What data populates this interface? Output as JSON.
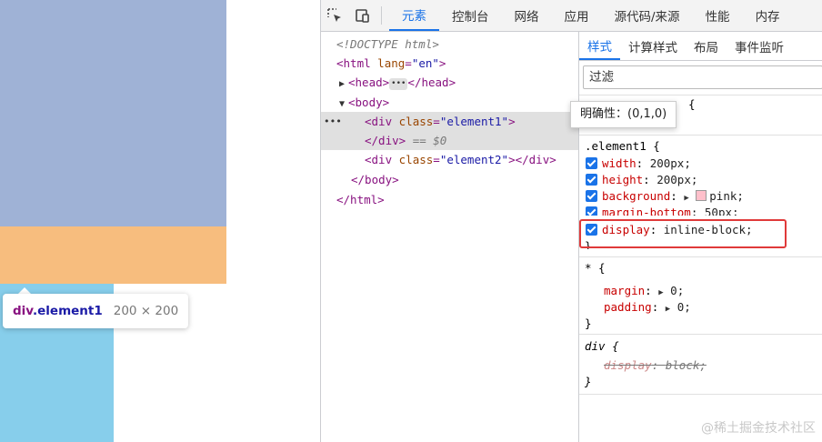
{
  "preview": {
    "tooltip_tag": "div",
    "tooltip_class": ".element1",
    "tooltip_size": "200 × 200"
  },
  "devtools": {
    "tabs": [
      "元素",
      "控制台",
      "网络",
      "应用",
      "源代码/来源",
      "性能",
      "内存"
    ],
    "dom": {
      "doctype": "<!DOCTYPE html>",
      "html_tag": "html",
      "html_attr": "lang",
      "html_val": "\"en\"",
      "head_open": "<head>",
      "head_close": "</head>",
      "body_open": "<body>",
      "div1_tag": "div",
      "class_attr": "class",
      "div1_class": "\"element1\"",
      "div_close": "</div>",
      "selected_marker": "== $0",
      "div2_class": "\"element2\"",
      "body_close": "</body>",
      "html_close": "</html>",
      "collapsed_dots": "•••"
    },
    "styles_tabs": [
      "样式",
      "计算样式",
      "布局",
      "事件监听"
    ],
    "filter_placeholder": "过滤",
    "specificity_tooltip": "明确性：(0,1,0)",
    "top_rule_fragment": "{",
    "element1_rule": {
      "selector": ".element1 {",
      "props": [
        {
          "name": "width",
          "value": "200px;"
        },
        {
          "name": "height",
          "value": "200px;"
        },
        {
          "name": "background",
          "value": "pink;"
        },
        {
          "name": "margin-bottom",
          "value": "50px;"
        },
        {
          "name": "display",
          "value": "inline-block;"
        }
      ],
      "close": "}"
    },
    "star_rule": {
      "selector": "* {",
      "props": [
        {
          "name": "margin",
          "value": "0;"
        },
        {
          "name": "padding",
          "value": "0;"
        }
      ],
      "close": "}"
    },
    "div_rule": {
      "selector": "div {",
      "prop": "display",
      "value": "block;",
      "close": "}"
    },
    "watermark": "@稀土掘金技术社区"
  }
}
